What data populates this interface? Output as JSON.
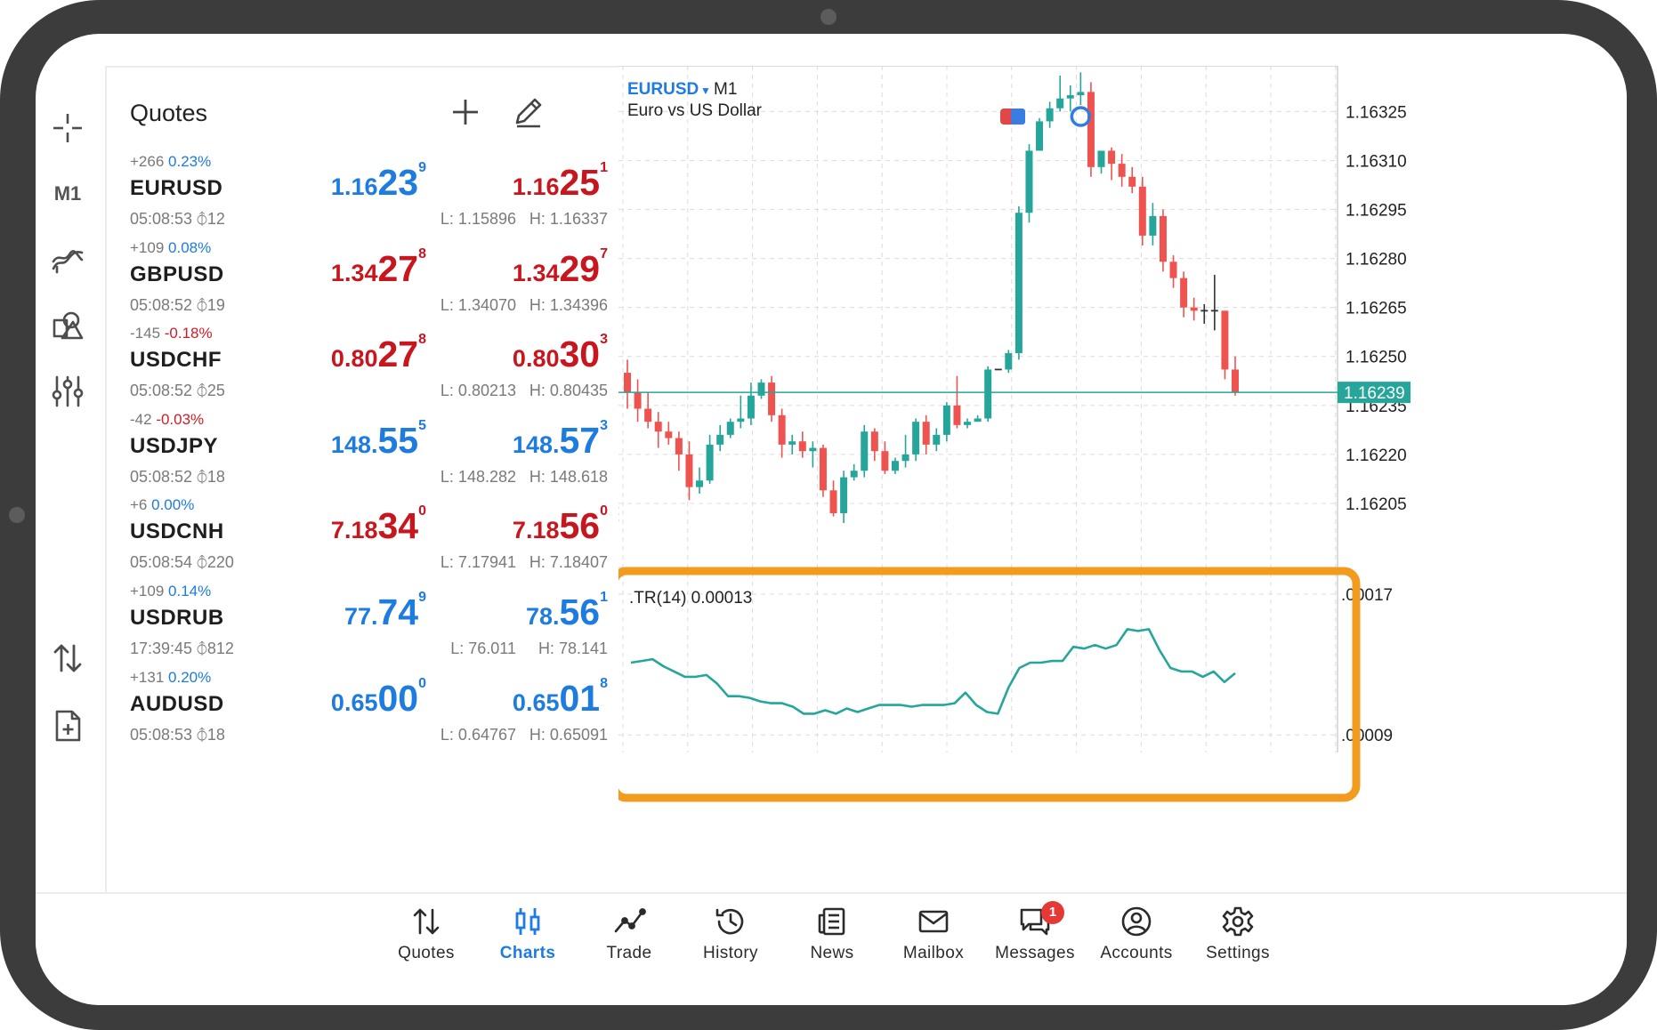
{
  "rail": {
    "timeframe": "M1"
  },
  "quotes": {
    "title": "Quotes",
    "items": [
      {
        "change_points": "+266",
        "change_pct": "0.23%",
        "change_dir": "pos",
        "symbol": "EURUSD",
        "time": "05:08:53",
        "spread": "12",
        "bid": {
          "pre": "1.16",
          "big": "23",
          "sup": "9",
          "color": "blue"
        },
        "ask": {
          "pre": "1.16",
          "big": "25",
          "sup": "1",
          "color": "red"
        },
        "low": "L: 1.15896",
        "high": "H: 1.16337"
      },
      {
        "change_points": "+109",
        "change_pct": "0.08%",
        "change_dir": "pos",
        "symbol": "GBPUSD",
        "time": "05:08:52",
        "spread": "19",
        "bid": {
          "pre": "1.34",
          "big": "27",
          "sup": "8",
          "color": "red"
        },
        "ask": {
          "pre": "1.34",
          "big": "29",
          "sup": "7",
          "color": "red"
        },
        "low": "L: 1.34070",
        "high": "H: 1.34396"
      },
      {
        "change_points": "-145",
        "change_pct": "-0.18%",
        "change_dir": "neg",
        "symbol": "USDCHF",
        "time": "05:08:52",
        "spread": "25",
        "bid": {
          "pre": "0.80",
          "big": "27",
          "sup": "8",
          "color": "red"
        },
        "ask": {
          "pre": "0.80",
          "big": "30",
          "sup": "3",
          "color": "red"
        },
        "low": "L: 0.80213",
        "high": "H: 0.80435"
      },
      {
        "change_points": "-42",
        "change_pct": "-0.03%",
        "change_dir": "neg",
        "symbol": "USDJPY",
        "time": "05:08:52",
        "spread": "18",
        "bid": {
          "pre": "148.",
          "big": "55",
          "sup": "5",
          "color": "blue"
        },
        "ask": {
          "pre": "148.",
          "big": "57",
          "sup": "3",
          "color": "blue"
        },
        "low": "L: 148.282",
        "high": "H: 148.618"
      },
      {
        "change_points": "+6",
        "change_pct": "0.00%",
        "change_dir": "pos",
        "symbol": "USDCNH",
        "time": "05:08:54",
        "spread": "220",
        "bid": {
          "pre": "7.18",
          "big": "34",
          "sup": "0",
          "color": "red"
        },
        "ask": {
          "pre": "7.18",
          "big": "56",
          "sup": "0",
          "color": "red"
        },
        "low": "L: 7.17941",
        "high": "H: 7.18407"
      },
      {
        "change_points": "+109",
        "change_pct": "0.14%",
        "change_dir": "pos",
        "symbol": "USDRUB",
        "time": "17:39:45",
        "spread": "812",
        "bid": {
          "pre": "77.",
          "big": "74",
          "sup": "9",
          "color": "blue"
        },
        "ask": {
          "pre": "78.",
          "big": "56",
          "sup": "1",
          "color": "blue"
        },
        "low": "L: 76.011",
        "high": "H: 78.141"
      },
      {
        "change_points": "+131",
        "change_pct": "0.20%",
        "change_dir": "pos",
        "symbol": "AUDUSD",
        "time": "05:08:53",
        "spread": "18",
        "bid": {
          "pre": "0.65",
          "big": "00",
          "sup": "0",
          "color": "blue"
        },
        "ask": {
          "pre": "0.65",
          "big": "01",
          "sup": "8",
          "color": "blue"
        },
        "low": "L: 0.64767",
        "high": "H: 0.65091"
      }
    ]
  },
  "chart": {
    "symbol": "EURUSD",
    "timeframe": "M1",
    "description": "Euro vs US Dollar",
    "current_price_label": "1.16239",
    "price_ticks": [
      "1.16325",
      "1.16310",
      "1.16295",
      "1.16280",
      "1.16265",
      "1.16250",
      "1.16235",
      "1.16220",
      "1.16205"
    ],
    "indicator_label": ".TR(14) 0.00013",
    "indicator_ticks": [
      ".00017",
      ".00009"
    ],
    "colors": {
      "bull": "#26a69a",
      "bear": "#ef5350",
      "highlight": "#f29b1f"
    }
  },
  "chart_data": [
    {
      "type": "candlestick",
      "title": "EURUSD M1",
      "xlabel": "",
      "ylabel": "",
      "y_ticks": [
        1.16205,
        1.1622,
        1.16235,
        1.1625,
        1.16265,
        1.1628,
        1.16295,
        1.1631,
        1.16325
      ],
      "ylim": [
        1.16196,
        1.16339
      ],
      "current_price": 1.16239,
      "ohlc": [
        [
          1.16245,
          1.16249,
          1.16234,
          1.16239
        ],
        [
          1.16239,
          1.16243,
          1.1623,
          1.16234
        ],
        [
          1.16234,
          1.16239,
          1.16228,
          1.1623
        ],
        [
          1.1623,
          1.16233,
          1.16222,
          1.16227
        ],
        [
          1.16227,
          1.1623,
          1.16223,
          1.16225
        ],
        [
          1.16225,
          1.16227,
          1.16215,
          1.1622
        ],
        [
          1.1622,
          1.16224,
          1.16206,
          1.1621
        ],
        [
          1.1621,
          1.16216,
          1.16208,
          1.16212
        ],
        [
          1.16212,
          1.16226,
          1.16211,
          1.16223
        ],
        [
          1.16223,
          1.16229,
          1.16221,
          1.16226
        ],
        [
          1.16226,
          1.16231,
          1.16225,
          1.1623
        ],
        [
          1.1623,
          1.16238,
          1.16228,
          1.16231
        ],
        [
          1.16231,
          1.16242,
          1.16229,
          1.16238
        ],
        [
          1.16238,
          1.16243,
          1.16237,
          1.16242
        ],
        [
          1.16242,
          1.16244,
          1.1623,
          1.16232
        ],
        [
          1.16232,
          1.16234,
          1.16219,
          1.16223
        ],
        [
          1.16223,
          1.16226,
          1.1622,
          1.16224
        ],
        [
          1.16224,
          1.16227,
          1.16219,
          1.16221
        ],
        [
          1.16221,
          1.16224,
          1.16216,
          1.16222
        ],
        [
          1.16222,
          1.16223,
          1.16207,
          1.16209
        ],
        [
          1.16209,
          1.16212,
          1.16201,
          1.16202
        ],
        [
          1.16202,
          1.16215,
          1.16199,
          1.16213
        ],
        [
          1.16213,
          1.16217,
          1.16212,
          1.16215
        ],
        [
          1.16215,
          1.16229,
          1.16213,
          1.16227
        ],
        [
          1.16227,
          1.16228,
          1.16218,
          1.16221
        ],
        [
          1.16221,
          1.16224,
          1.16214,
          1.16215
        ],
        [
          1.16215,
          1.16219,
          1.16214,
          1.16218
        ],
        [
          1.16218,
          1.16226,
          1.16216,
          1.1622
        ],
        [
          1.1622,
          1.16231,
          1.16218,
          1.1623
        ],
        [
          1.1623,
          1.16232,
          1.1622,
          1.16223
        ],
        [
          1.16223,
          1.16228,
          1.16221,
          1.16226
        ],
        [
          1.16226,
          1.16236,
          1.16224,
          1.16235
        ],
        [
          1.16235,
          1.16244,
          1.16228,
          1.16229
        ],
        [
          1.16229,
          1.16231,
          1.16228,
          1.1623
        ],
        [
          1.1623,
          1.16232,
          1.1623,
          1.16231
        ],
        [
          1.16231,
          1.16247,
          1.1623,
          1.16246
        ],
        [
          1.16246,
          1.16246,
          1.16246,
          1.16246
        ],
        [
          1.16246,
          1.16252,
          1.16245,
          1.16251
        ],
        [
          1.16251,
          1.16296,
          1.16249,
          1.16294
        ],
        [
          1.16294,
          1.16315,
          1.16291,
          1.16313
        ],
        [
          1.16313,
          1.16323,
          1.16313,
          1.16322
        ],
        [
          1.16322,
          1.16328,
          1.1632,
          1.16326
        ],
        [
          1.16326,
          1.16336,
          1.16325,
          1.16329
        ],
        [
          1.16329,
          1.16333,
          1.16325,
          1.1633
        ],
        [
          1.1633,
          1.16337,
          1.16327,
          1.16331
        ],
        [
          1.16331,
          1.16334,
          1.16305,
          1.16308
        ],
        [
          1.16308,
          1.1631,
          1.16306,
          1.16313
        ],
        [
          1.16313,
          1.16314,
          1.16304,
          1.16309
        ],
        [
          1.16309,
          1.16312,
          1.16302,
          1.16305
        ],
        [
          1.16305,
          1.16308,
          1.163,
          1.16302
        ],
        [
          1.16302,
          1.16305,
          1.16284,
          1.16287
        ],
        [
          1.16287,
          1.16297,
          1.16284,
          1.16293
        ],
        [
          1.16293,
          1.16295,
          1.16276,
          1.16279
        ],
        [
          1.16279,
          1.16281,
          1.16271,
          1.16274
        ],
        [
          1.16274,
          1.16276,
          1.16262,
          1.16265
        ],
        [
          1.16265,
          1.16268,
          1.16261,
          1.16264
        ],
        [
          1.16264,
          1.16266,
          1.1626,
          1.16264
        ],
        [
          1.16264,
          1.16275,
          1.16258,
          1.16264
        ],
        [
          1.16264,
          1.16264,
          1.16243,
          1.16246
        ],
        [
          1.16246,
          1.1625,
          1.16238,
          1.16239
        ]
      ],
      "indicator": {
        "name": ".TR(14)",
        "current": 0.00013,
        "y_ticks": [
          9e-05,
          0.00017
        ],
        "ylim": [
          8e-05,
          0.000178
        ],
        "values": [
          0.000131,
          0.000132,
          0.000133,
          0.000129,
          0.000126,
          0.000123,
          0.000123,
          0.000124,
          0.000119,
          0.000112,
          0.000112,
          0.000111,
          0.000109,
          0.000108,
          0.000108,
          0.000106,
          0.000102,
          0.000102,
          0.000104,
          0.000102,
          0.000105,
          0.000103,
          0.000105,
          0.000107,
          0.000107,
          0.000107,
          0.000106,
          0.000107,
          0.000107,
          0.000107,
          0.000108,
          0.000114,
          0.000107,
          0.000103,
          0.000102,
          0.000117,
          0.000128,
          0.000131,
          0.000131,
          0.000132,
          0.000132,
          0.00014,
          0.000139,
          0.000141,
          0.000139,
          0.000141,
          0.00015,
          0.000149,
          0.00015,
          0.000138,
          0.000128,
          0.000126,
          0.000126,
          0.000123,
          0.000126,
          0.00012,
          0.000125
        ]
      }
    }
  ],
  "nav": {
    "items": [
      {
        "label": "Quotes",
        "icon": "quotes-icon"
      },
      {
        "label": "Charts",
        "icon": "charts-icon"
      },
      {
        "label": "Trade",
        "icon": "trade-icon"
      },
      {
        "label": "History",
        "icon": "history-icon"
      },
      {
        "label": "News",
        "icon": "news-icon"
      },
      {
        "label": "Mailbox",
        "icon": "mailbox-icon"
      },
      {
        "label": "Messages",
        "icon": "messages-icon",
        "badge": "1"
      },
      {
        "label": "Accounts",
        "icon": "accounts-icon"
      },
      {
        "label": "Settings",
        "icon": "settings-icon"
      }
    ]
  }
}
